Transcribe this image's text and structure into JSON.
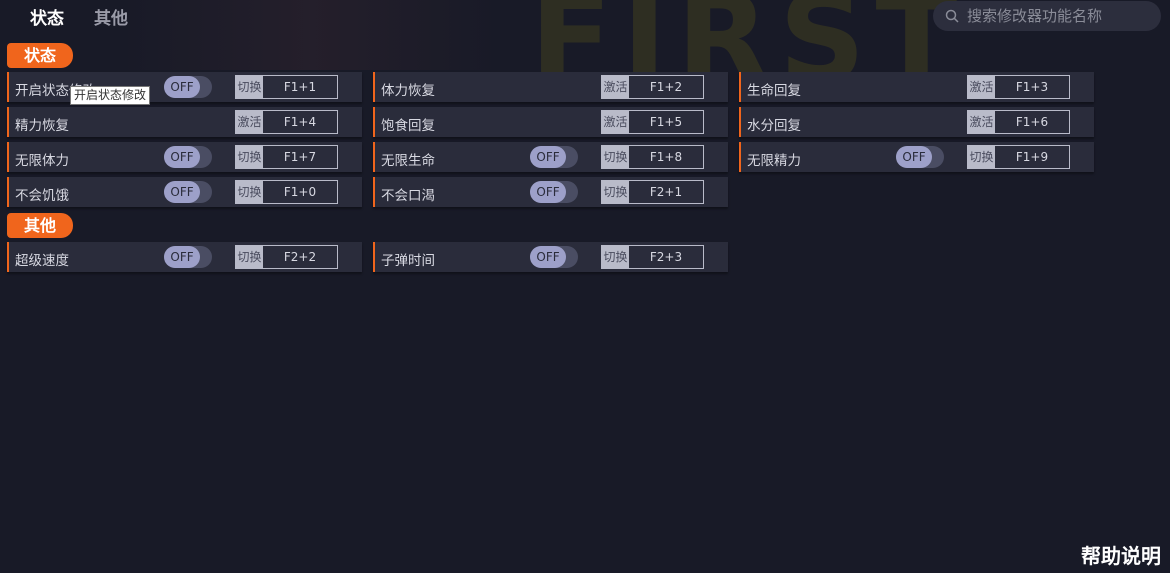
{
  "tabs": [
    {
      "label": "状态",
      "active": true
    },
    {
      "label": "其他",
      "active": false
    }
  ],
  "search": {
    "placeholder": "搜索修改器功能名称"
  },
  "sections": [
    {
      "title": "状态"
    },
    {
      "title": "其他"
    }
  ],
  "items": [
    {
      "label": "开启状态修改",
      "toggle": "OFF",
      "type": "切换",
      "key": "F1+1"
    },
    {
      "label": "体力恢复",
      "toggle": null,
      "type": "激活",
      "key": "F1+2"
    },
    {
      "label": "生命回复",
      "toggle": null,
      "type": "激活",
      "key": "F1+3"
    },
    {
      "label": "精力恢复",
      "toggle": null,
      "type": "激活",
      "key": "F1+4"
    },
    {
      "label": "饱食回复",
      "toggle": null,
      "type": "激活",
      "key": "F1+5"
    },
    {
      "label": "水分回复",
      "toggle": null,
      "type": "激活",
      "key": "F1+6"
    },
    {
      "label": "无限体力",
      "toggle": "OFF",
      "type": "切换",
      "key": "F1+7"
    },
    {
      "label": "无限生命",
      "toggle": "OFF",
      "type": "切换",
      "key": "F1+8"
    },
    {
      "label": "无限精力",
      "toggle": "OFF",
      "type": "切换",
      "key": "F1+9"
    },
    {
      "label": "不会饥饿",
      "toggle": "OFF",
      "type": "切换",
      "key": "F1+0"
    },
    {
      "label": "不会口渴",
      "toggle": "OFF",
      "type": "切换",
      "key": "F2+1"
    },
    {
      "label": "超级速度",
      "toggle": "OFF",
      "type": "切换",
      "key": "F2+2"
    },
    {
      "label": "子弹时间",
      "toggle": "OFF",
      "type": "切换",
      "key": "F2+3"
    }
  ],
  "tooltip": "开启状态修改",
  "help": "帮助说明",
  "colors": {
    "accent": "#f0651c",
    "background": "#181a27",
    "cell": "#2a2c3b"
  }
}
